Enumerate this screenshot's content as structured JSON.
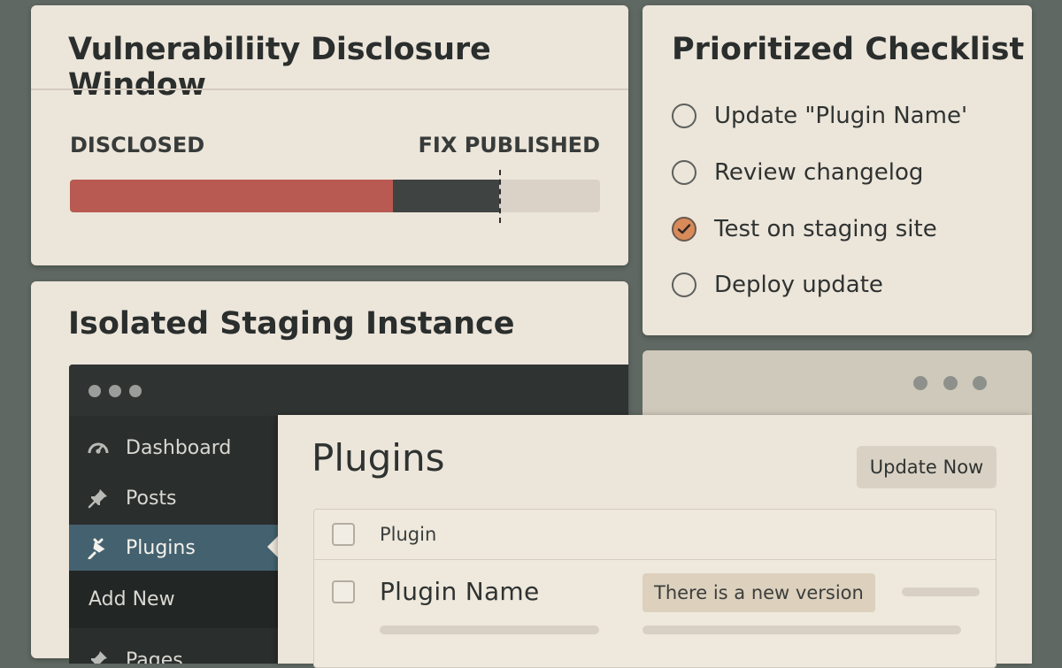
{
  "disclosure": {
    "title": "Vulnerabiliity Disclosure Window",
    "label_left": "DISCLOSED",
    "label_right": "FIX PUBLISHED",
    "disclosed_fraction": 0.61,
    "published_fraction": 0.81,
    "colors": {
      "disclosed": "#b85a52",
      "pending": "#3f4443",
      "track": "#dad2c6"
    }
  },
  "checklist": {
    "title": "Prioritized Checklist",
    "items": [
      {
        "label": "Update \"Plugin Name'",
        "checked": false
      },
      {
        "label": "Review changelog",
        "checked": false
      },
      {
        "label": "Test on staging site",
        "checked": true
      },
      {
        "label": "Deploy update",
        "checked": false
      }
    ],
    "check_color": "#d88a58"
  },
  "staging": {
    "title": "Isolated Staging Instance"
  },
  "wp_admin": {
    "sidebar": [
      {
        "label": "Dashboard",
        "icon": "dashboard-gauge-icon"
      },
      {
        "label": "Posts",
        "icon": "pushpin-icon"
      },
      {
        "label": "Plugins",
        "icon": "plug-icon",
        "active": true
      },
      {
        "label": "Add New",
        "icon": "",
        "submenu": true
      },
      {
        "label": "Pages",
        "icon": "pages-icon"
      }
    ],
    "active_color": "#44616f"
  },
  "plugins_page": {
    "title": "Plugins",
    "update_button": "Update Now",
    "column_header": "Plugin",
    "row": {
      "name": "Plugin Name",
      "notice": "There is a new version"
    }
  }
}
